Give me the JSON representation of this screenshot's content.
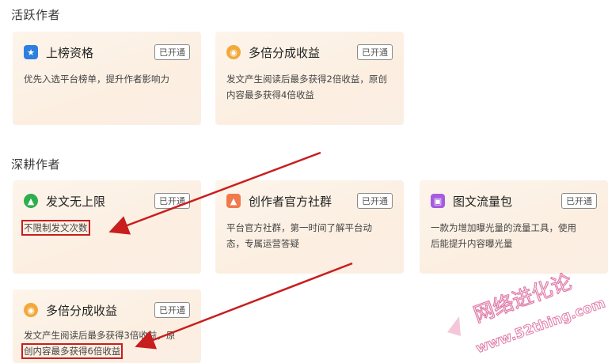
{
  "sections": [
    {
      "title": "活跃作者"
    },
    {
      "title": "深耕作者"
    }
  ],
  "cards": [
    {
      "title": "上榜资格",
      "badge": "已开通",
      "desc": "优先入选平台榜单，提升作者影响力",
      "icon": "star-icon",
      "icon_color": "#2e7fe0"
    },
    {
      "title": "多倍分成收益",
      "badge": "已开通",
      "desc": "发文产生阅读后最多获得2倍收益，原创内容最多获得4倍收益",
      "icon": "coin-icon",
      "icon_color": "#f2a93b"
    },
    {
      "title": "发文无上限",
      "badge": "已开通",
      "desc": "不限制发文次数",
      "icon": "arrow-up-icon",
      "icon_color": "#2fae4e"
    },
    {
      "title": "创作者官方社群",
      "badge": "已开通",
      "desc_line1": "平台官方社群，第一时间了解平台动",
      "desc_line2": "态，专属运营答疑",
      "icon": "community-icon",
      "icon_color": "#f07a4b"
    },
    {
      "title": "图文流量包",
      "badge": "已开通",
      "desc_line1": "一款为增加曝光量的流量工具，使用",
      "desc_line2": "后能提升内容曝光量",
      "icon": "image-icon",
      "icon_color": "#a65be0"
    },
    {
      "title": "多倍分成收益",
      "badge": "已开通",
      "desc_line1": "发文产生阅读后最多获得3倍收益，原",
      "desc_line2": "创内容最多获得6倍收益",
      "icon": "coin-icon",
      "icon_color": "#f2a93b"
    }
  ],
  "watermark": {
    "text": "网络进化论",
    "url": "www.52thing.com"
  },
  "colors": {
    "highlight": "#c81e1e",
    "card_bg": "#fcefe2"
  }
}
